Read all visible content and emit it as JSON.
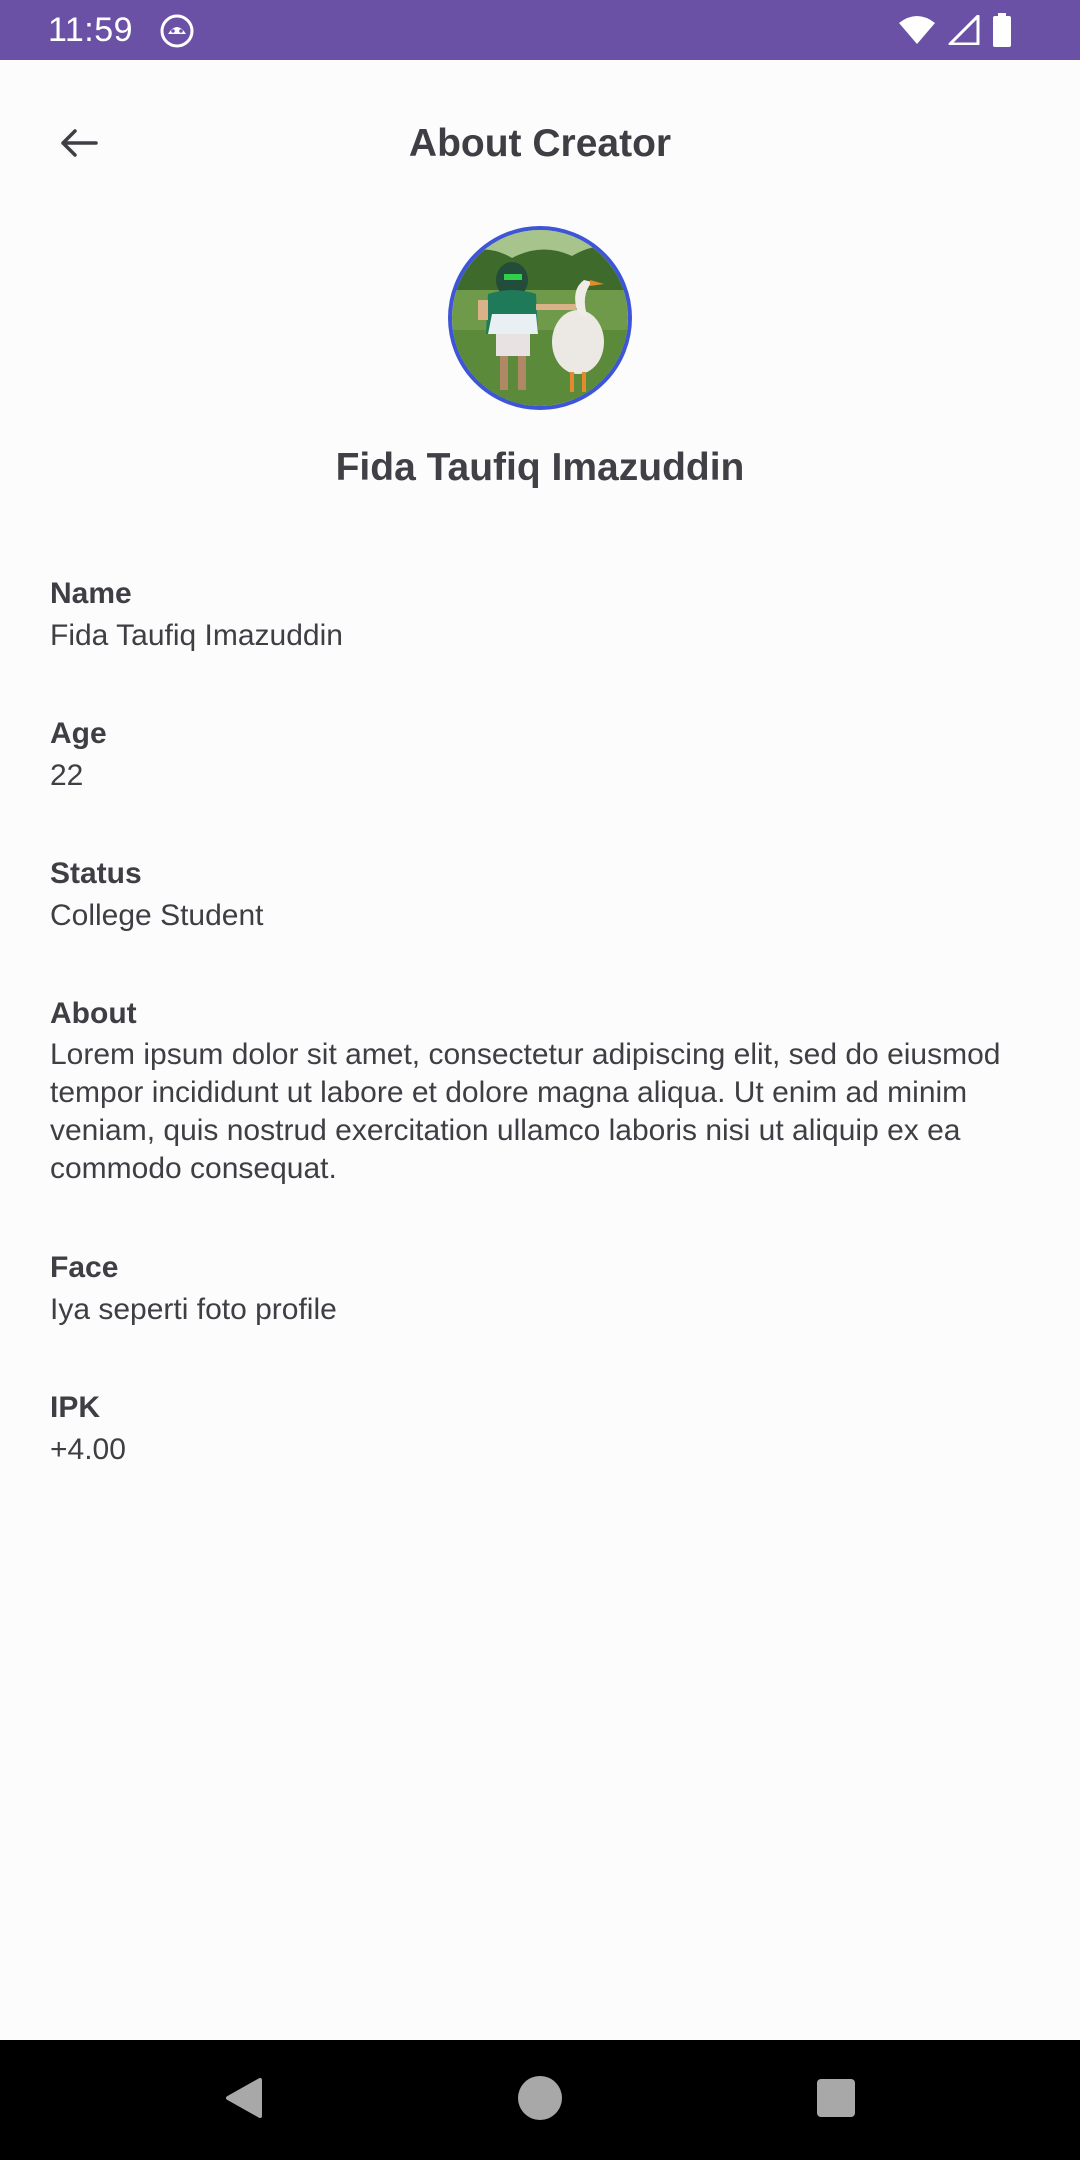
{
  "status_bar": {
    "time": "11:59",
    "app_icon": "android-face-icon",
    "icons": [
      "wifi-icon",
      "signal-icon",
      "battery-icon"
    ],
    "background_color": "#6a51a6"
  },
  "app_bar": {
    "title": "About Creator",
    "back_icon": "arrow-left-icon"
  },
  "profile": {
    "name": "Fida Taufiq Imazuddin",
    "avatar_border_color": "#3d55d6"
  },
  "info": [
    {
      "label": "Name",
      "value": "Fida Taufiq Imazuddin"
    },
    {
      "label": "Age",
      "value": "22"
    },
    {
      "label": "Status",
      "value": "College Student"
    },
    {
      "label": "About",
      "value": "Lorem ipsum dolor sit amet, consectetur adipiscing elit, sed do eiusmod tempor incididunt ut labore et dolore magna aliqua. Ut enim ad minim veniam, quis nostrud exercitation ullamco laboris nisi ut aliquip ex ea commodo consequat."
    },
    {
      "label": "Face",
      "value": "Iya seperti foto profile"
    },
    {
      "label": "IPK",
      "value": "+4.00"
    }
  ],
  "nav_bar": {
    "buttons": [
      "back-triangle-icon",
      "home-circle-icon",
      "recents-square-icon"
    ]
  }
}
